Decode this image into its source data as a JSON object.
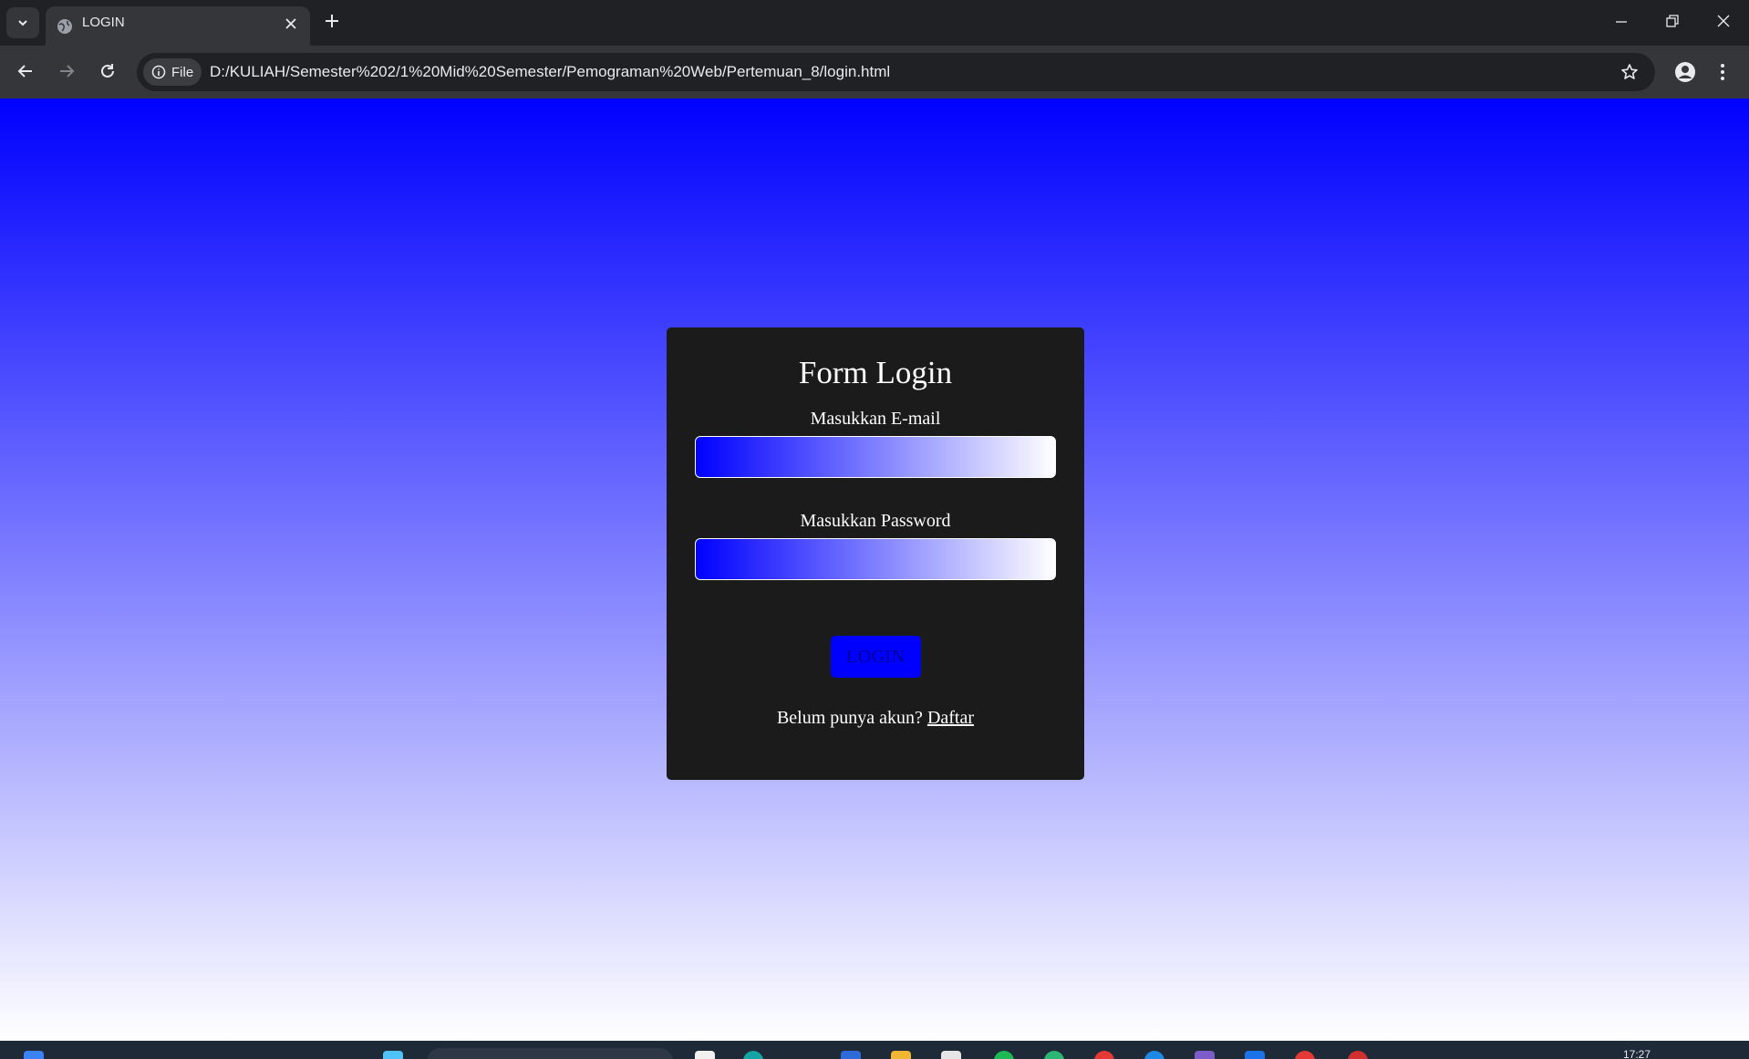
{
  "browser": {
    "tab": {
      "title": "LOGIN"
    },
    "omnibox": {
      "chip_label": "File",
      "url": "D:/KULIAH/Semester%202/1%20Mid%20Semester/Pemograman%20Web/Pertemuan_8/login.html"
    }
  },
  "form": {
    "title": "Form Login",
    "email_label": "Masukkan E-mail",
    "email_value": "",
    "password_label": "Masukkan Password",
    "password_value": "",
    "login_button": "LOGIN",
    "register_prompt": "Belum punya akun? ",
    "register_link": "Daftar"
  },
  "taskbar": {
    "clock": "17:27"
  },
  "colors": {
    "page_gradient_top": "#0000ff",
    "page_gradient_bottom": "#ffffff",
    "card_background": "#1b1b1b",
    "button": "#0000ff",
    "browser_chrome": "#202124",
    "toolbar": "#35363a"
  },
  "icons": [
    "tab-search-icon",
    "globe-icon",
    "close-icon",
    "plus-icon",
    "minimize-icon",
    "restore-icon",
    "window-close-icon",
    "back-icon",
    "forward-icon",
    "reload-icon",
    "info-icon",
    "star-icon",
    "profile-icon",
    "kebab-menu-icon"
  ]
}
